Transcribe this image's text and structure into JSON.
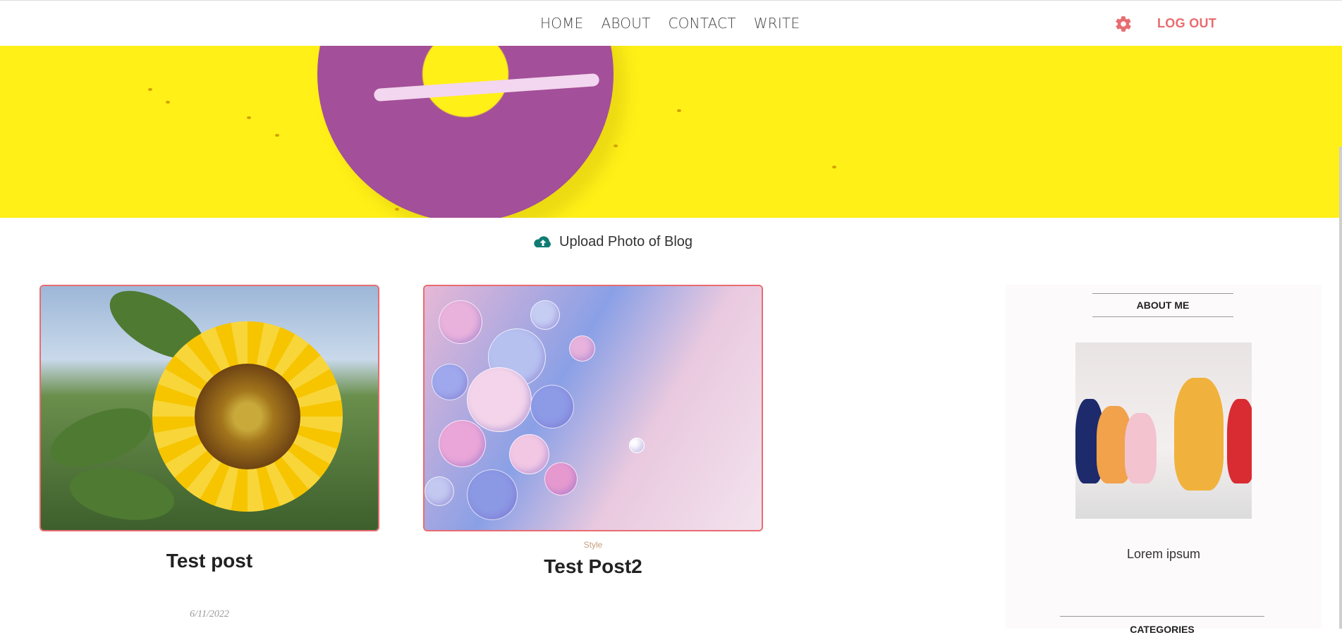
{
  "nav": {
    "items": [
      "HOME",
      "ABOUT",
      "CONTACT",
      "WRITE"
    ],
    "logout": "LOG OUT",
    "settings_icon": "gear-icon",
    "accent_color": "#e86c70"
  },
  "upload": {
    "icon": "cloud-upload-icon",
    "label": "Upload Photo of Blog"
  },
  "posts": [
    {
      "category": "",
      "title": "Test post",
      "date": "6/11/2022"
    },
    {
      "category": "Style",
      "title": "Test Post2",
      "date": ""
    }
  ],
  "sidebar": {
    "about_title": "ABOUT ME",
    "about_text": "Lorem ipsum",
    "categories_title": "CATEGORIES"
  }
}
